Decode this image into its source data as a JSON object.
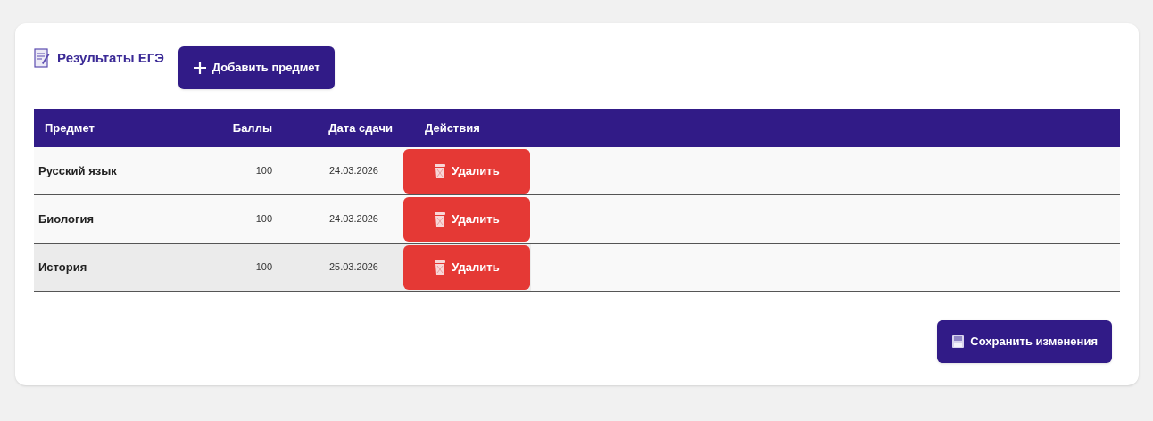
{
  "title": "Результаты ЕГЭ",
  "add_button": "Добавить предмет",
  "table": {
    "columns": [
      "Предмет",
      "Баллы",
      "Дата сдачи",
      "Действия"
    ],
    "rows": [
      {
        "subject": "Русский язык",
        "score": "100",
        "date": "24.03.2026",
        "action": "Удалить",
        "hovered": false
      },
      {
        "subject": "Биология",
        "score": "100",
        "date": "24.03.2026",
        "action": "Удалить",
        "hovered": false
      },
      {
        "subject": "История",
        "score": "100",
        "date": "25.03.2026",
        "action": "Удалить",
        "hovered": true
      }
    ]
  },
  "save_button": "Сохранить изменения"
}
